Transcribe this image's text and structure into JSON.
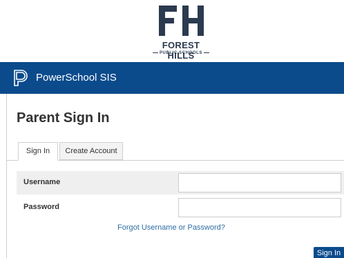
{
  "logo": {
    "monogram": "FH",
    "line1": "FOREST HILLS",
    "line2": "PUBLIC SCHOOLS",
    "color": "#2b3a4f"
  },
  "header": {
    "app_title": "PowerSchool SIS",
    "bar_color": "#0b4b8c",
    "icon": "powerschool-logo-icon"
  },
  "page": {
    "title": "Parent Sign In"
  },
  "tabs": [
    {
      "label": "Sign In",
      "active": true
    },
    {
      "label": "Create Account",
      "active": false
    }
  ],
  "form": {
    "username_label": "Username",
    "username_value": "",
    "password_label": "Password",
    "password_value": "",
    "forgot_link": "Forgot Username or Password?",
    "submit_label": "Sign In"
  }
}
